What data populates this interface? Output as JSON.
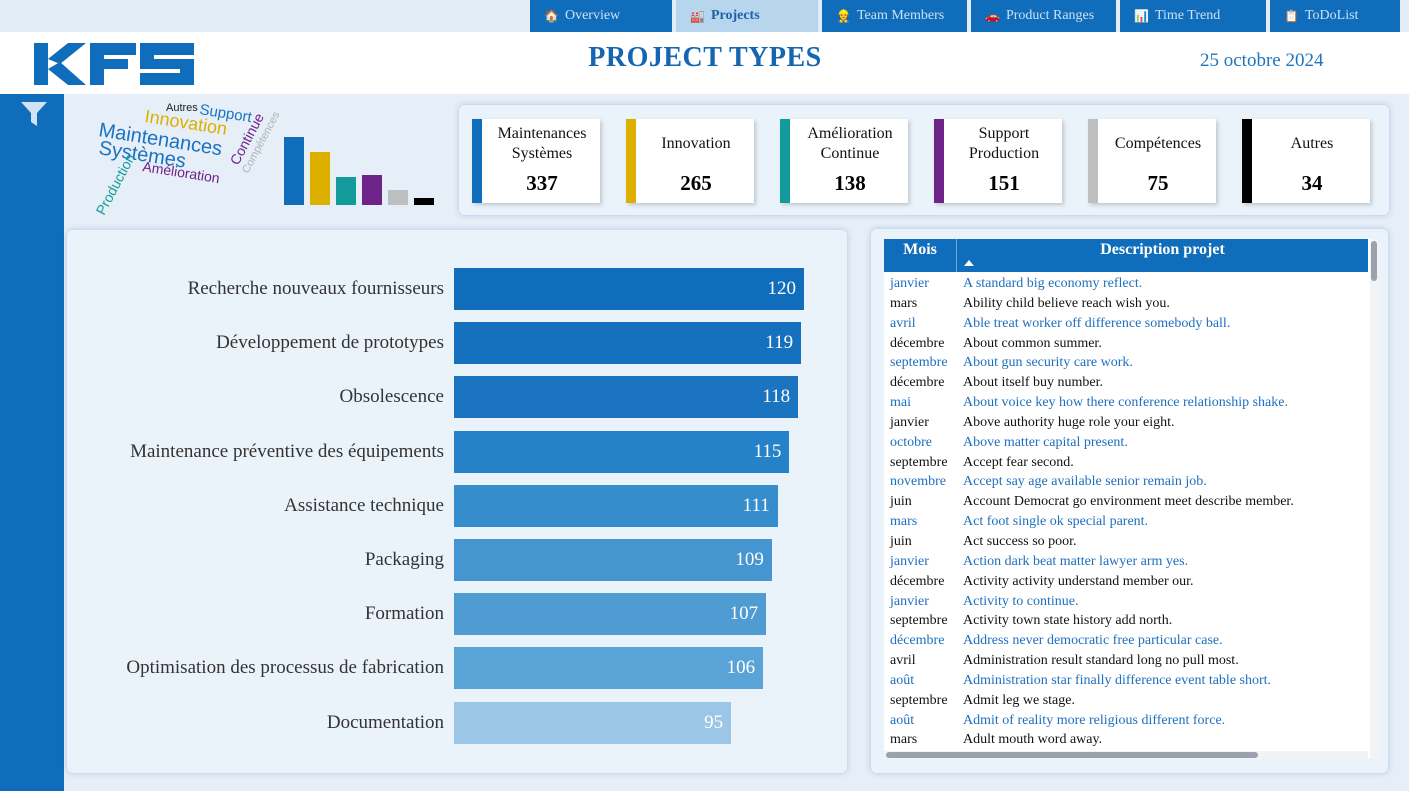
{
  "nav": {
    "tabs": [
      {
        "label": "Overview",
        "icon": "home-icon"
      },
      {
        "label": "Projects",
        "icon": "factory-icon"
      },
      {
        "label": "Team Members",
        "icon": "worker-icon"
      },
      {
        "label": "Product Ranges",
        "icon": "car-icon"
      },
      {
        "label": "Time Trend",
        "icon": "chart-icon"
      },
      {
        "label": "ToDoList",
        "icon": "clipboard-icon"
      }
    ],
    "active_tab": "Projects"
  },
  "header": {
    "logo_text": "KFS",
    "title": "PROJECT TYPES",
    "date": "25 octobre 2024"
  },
  "colors": {
    "brand": "#0f6dbb",
    "maintenances": "#0f6dbb",
    "innovation": "#ddb000",
    "amelioration": "#139b9b",
    "support": "#6e2389",
    "competences": "#bdbfc1",
    "autres": "#000000"
  },
  "wordcloud": {
    "words": [
      {
        "text": "Maintenances",
        "color": "#1a73c2"
      },
      {
        "text": "Systèmes",
        "color": "#1a73c2"
      },
      {
        "text": "Innovation",
        "color": "#ddb000"
      },
      {
        "text": "Support",
        "color": "#1a73c2"
      },
      {
        "text": "Autres",
        "color": "#222222"
      },
      {
        "text": "Continue",
        "color": "#6e2389"
      },
      {
        "text": "Compétences",
        "color": "#b0b3b6"
      },
      {
        "text": "Production",
        "color": "#139b9b"
      },
      {
        "text": "Amélioration",
        "color": "#6e2389"
      }
    ]
  },
  "mini_chart": {
    "values": [
      337,
      265,
      138,
      151,
      75,
      34
    ],
    "colors": [
      "#0f6dbb",
      "#ddb000",
      "#139b9b",
      "#6e2389",
      "#bdbfc1",
      "#000000"
    ]
  },
  "kpis": [
    {
      "label": "Maintenances Systèmes",
      "value": "337",
      "color": "#0f6dbb"
    },
    {
      "label": "Innovation",
      "value": "265",
      "color": "#ddb000"
    },
    {
      "label": "Amélioration Continue",
      "value": "138",
      "color": "#139b9b"
    },
    {
      "label": "Support Production",
      "value": "151",
      "color": "#6e2389"
    },
    {
      "label": "Compétences",
      "value": "75",
      "color": "#bdbfc1"
    },
    {
      "label": "Autres",
      "value": "34",
      "color": "#000000"
    }
  ],
  "chart_data": {
    "type": "bar",
    "orientation": "horizontal",
    "categories": [
      "Recherche nouveaux fournisseurs",
      "Développement de prototypes",
      "Obsolescence",
      "Maintenance préventive des équipements",
      "Assistance technique",
      "Packaging",
      "Formation",
      "Optimisation des processus de fabrication",
      "Documentation"
    ],
    "values": [
      120,
      119,
      118,
      115,
      111,
      109,
      107,
      106,
      95
    ],
    "colors": [
      "#0f6dbb",
      "#1570bd",
      "#1a74c0",
      "#2582c8",
      "#368dcc",
      "#4495d0",
      "#4f9cd3",
      "#5aa3d6",
      "#9cc6e6"
    ],
    "xlim": [
      0,
      120
    ],
    "data_labels": true,
    "grid": false,
    "legend": "none"
  },
  "table": {
    "headers": {
      "mois": "Mois",
      "description": "Description projet"
    },
    "sort": "description-ascending",
    "rows": [
      {
        "mois": "janvier",
        "desc": "A standard big economy reflect."
      },
      {
        "mois": "mars",
        "desc": "Ability child believe reach wish you."
      },
      {
        "mois": "avril",
        "desc": "Able treat worker off difference somebody ball."
      },
      {
        "mois": "décembre",
        "desc": "About common summer."
      },
      {
        "mois": "septembre",
        "desc": "About gun security care work."
      },
      {
        "mois": "décembre",
        "desc": "About itself buy number."
      },
      {
        "mois": "mai",
        "desc": "About voice key how there conference relationship shake."
      },
      {
        "mois": "janvier",
        "desc": "Above authority huge role your eight."
      },
      {
        "mois": "octobre",
        "desc": "Above matter capital present."
      },
      {
        "mois": "septembre",
        "desc": "Accept fear second."
      },
      {
        "mois": "novembre",
        "desc": "Accept say age available senior remain job."
      },
      {
        "mois": "juin",
        "desc": "Account Democrat go environment meet describe member."
      },
      {
        "mois": "mars",
        "desc": "Act foot single ok special parent."
      },
      {
        "mois": "juin",
        "desc": "Act success so poor."
      },
      {
        "mois": "janvier",
        "desc": "Action dark beat matter lawyer arm yes."
      },
      {
        "mois": "décembre",
        "desc": "Activity activity understand member our."
      },
      {
        "mois": "janvier",
        "desc": "Activity to continue."
      },
      {
        "mois": "septembre",
        "desc": "Activity town state history add north."
      },
      {
        "mois": "décembre",
        "desc": "Address never democratic free particular case."
      },
      {
        "mois": "avril",
        "desc": "Administration result standard long no pull most."
      },
      {
        "mois": "août",
        "desc": "Administration star finally difference event table short."
      },
      {
        "mois": "septembre",
        "desc": "Admit leg we stage."
      },
      {
        "mois": "août",
        "desc": "Admit of reality more religious different force."
      },
      {
        "mois": "mars",
        "desc": "Adult mouth word away."
      }
    ]
  }
}
